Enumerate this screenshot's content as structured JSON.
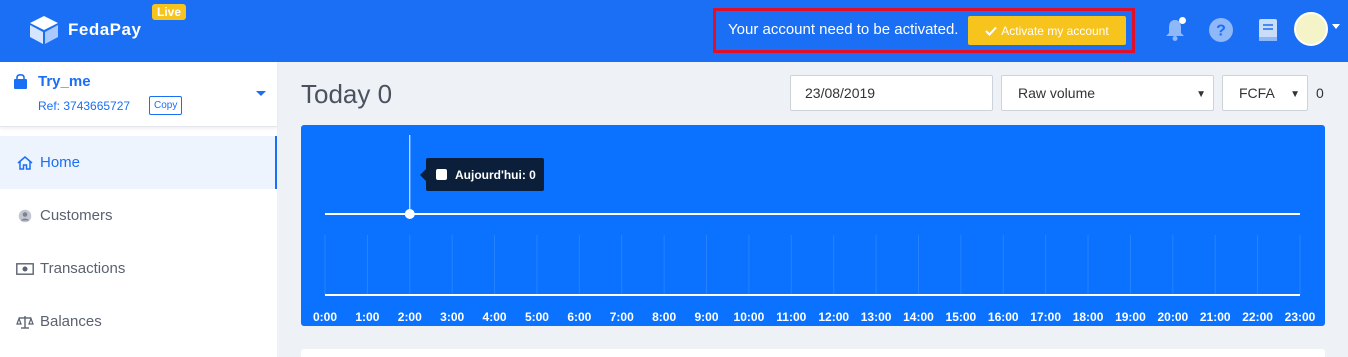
{
  "brand": {
    "name": "FedaPay",
    "mode_badge": "Live"
  },
  "activation": {
    "message": "Your account need to be activated.",
    "button_label": "Activate my account"
  },
  "header_icons": [
    "bell-icon",
    "help-icon",
    "docs-icon"
  ],
  "account": {
    "name": "Try_me",
    "ref": "Ref: 3743665727",
    "copy_label": "Copy"
  },
  "nav": [
    {
      "label": "Home",
      "icon": "home-icon",
      "active": true
    },
    {
      "label": "Customers",
      "icon": "customer-icon",
      "active": false
    },
    {
      "label": "Transactions",
      "icon": "money-icon",
      "active": false
    },
    {
      "label": "Balances",
      "icon": "scale-icon",
      "active": false
    }
  ],
  "main": {
    "title": "Today 0",
    "date": "23/08/2019",
    "metric_select": "Raw volume",
    "currency_select": "FCFA",
    "total": "0"
  },
  "chart_data": {
    "type": "line",
    "x": [
      "0:00",
      "1:00",
      "2:00",
      "3:00",
      "4:00",
      "5:00",
      "6:00",
      "7:00",
      "8:00",
      "9:00",
      "10:00",
      "11:00",
      "12:00",
      "13:00",
      "14:00",
      "15:00",
      "16:00",
      "17:00",
      "18:00",
      "19:00",
      "20:00",
      "21:00",
      "22:00",
      "23:00"
    ],
    "series": [
      {
        "name": "Aujourd'hui",
        "values": [
          0,
          0,
          0,
          0,
          0,
          0,
          0,
          0,
          0,
          0,
          0,
          0,
          0,
          0,
          0,
          0,
          0,
          0,
          0,
          0,
          0,
          0,
          0,
          0
        ]
      }
    ],
    "tooltip": {
      "label": "Aujourd'hui: 0",
      "index": 2
    },
    "grid": true,
    "colors": {
      "background": "#0a72ff",
      "line": "#ffffff"
    }
  },
  "colors": {
    "primary": "#1a6ff4",
    "accent": "#f7c31d",
    "highlight_border": "#e0102a"
  }
}
